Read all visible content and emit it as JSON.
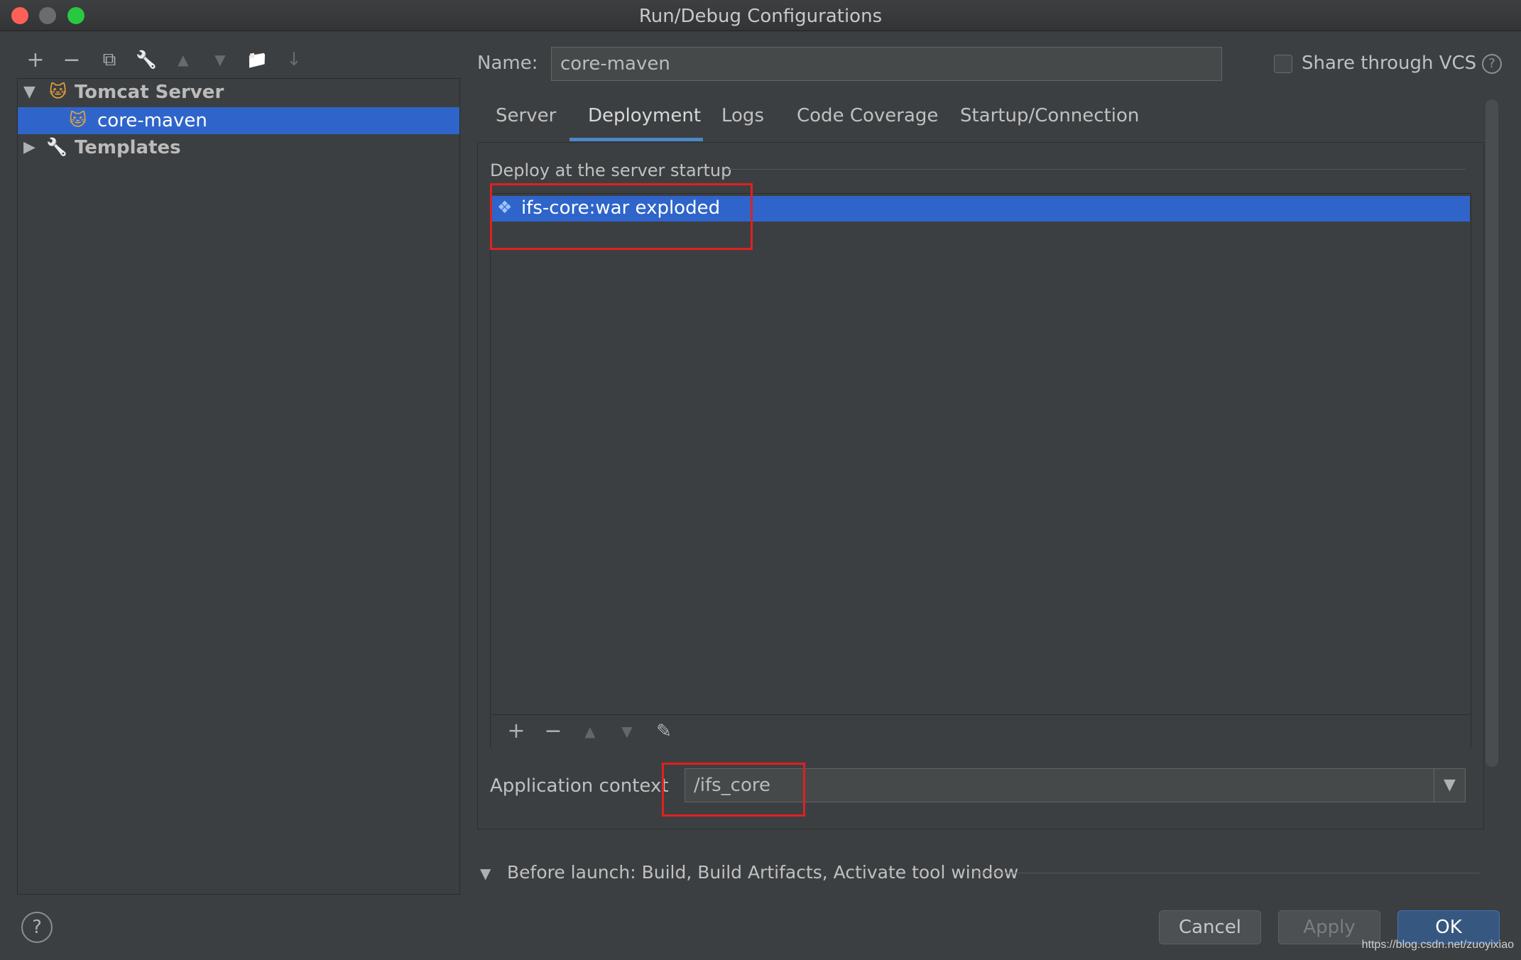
{
  "window": {
    "title": "Run/Debug Configurations"
  },
  "toolbar": {
    "add": "+",
    "remove": "−",
    "copy": "⧉",
    "wrench": "🔧",
    "up": "▲",
    "down": "▼",
    "folder": "📁",
    "sort": "↓"
  },
  "tree": {
    "tomcat_server": "Tomcat Server",
    "core_maven": "core-maven",
    "templates": "Templates"
  },
  "name": {
    "label": "Name:",
    "value": "core-maven"
  },
  "share": {
    "label": "Share through VCS"
  },
  "tabs": [
    "Server",
    "Deployment",
    "Logs",
    "Code Coverage",
    "Startup/Connection"
  ],
  "deployment": {
    "header": "Deploy at the server startup",
    "artifacts": [
      "ifs-core:war exploded"
    ]
  },
  "app_context": {
    "label": "Application context",
    "value": "/ifs_core"
  },
  "before_launch": {
    "label": "Before launch: Build, Build Artifacts, Activate tool window"
  },
  "buttons": {
    "cancel": "Cancel",
    "apply": "Apply",
    "ok": "OK"
  },
  "watermark": "https://blog.csdn.net/zuoyixiao",
  "colors": {
    "selection": "#2f65ca",
    "accent": "#4a88c7",
    "highlight": "#e02020"
  }
}
